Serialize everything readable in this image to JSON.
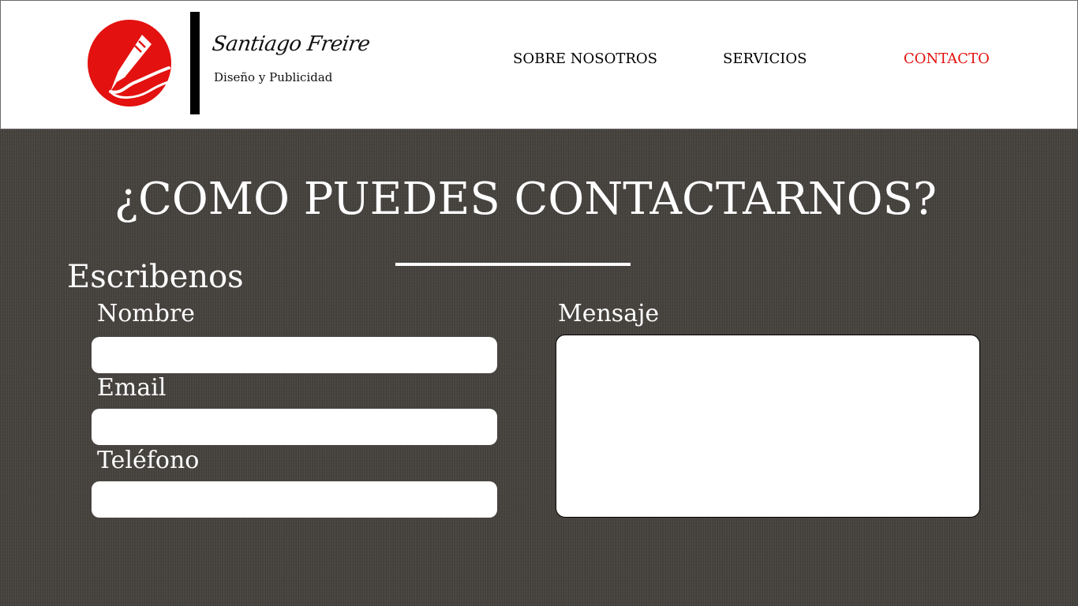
{
  "header": {
    "brand_name": "Santiago Freire",
    "brand_tagline": "Diseño y Publicidad",
    "logo_icon": "pen-nib-icon",
    "nav": {
      "about": "SOBRE NOSOTROS",
      "services": "SERVICIOS",
      "contact": "CONTACTO"
    },
    "active_nav": "contact"
  },
  "main": {
    "title": "¿COMO PUEDES CONTACTARNOS?",
    "section_title": "Escribenos",
    "form": {
      "name_label": "Nombre",
      "name_value": "",
      "email_label": "Email",
      "email_value": "",
      "phone_label": "Teléfono",
      "phone_value": "",
      "message_label": "Mensaje",
      "message_value": ""
    }
  },
  "colors": {
    "accent": "#e3110f",
    "background": "#474440",
    "header_background": "#ffffff",
    "text_light": "#ffffff",
    "text_dark": "#000000"
  }
}
